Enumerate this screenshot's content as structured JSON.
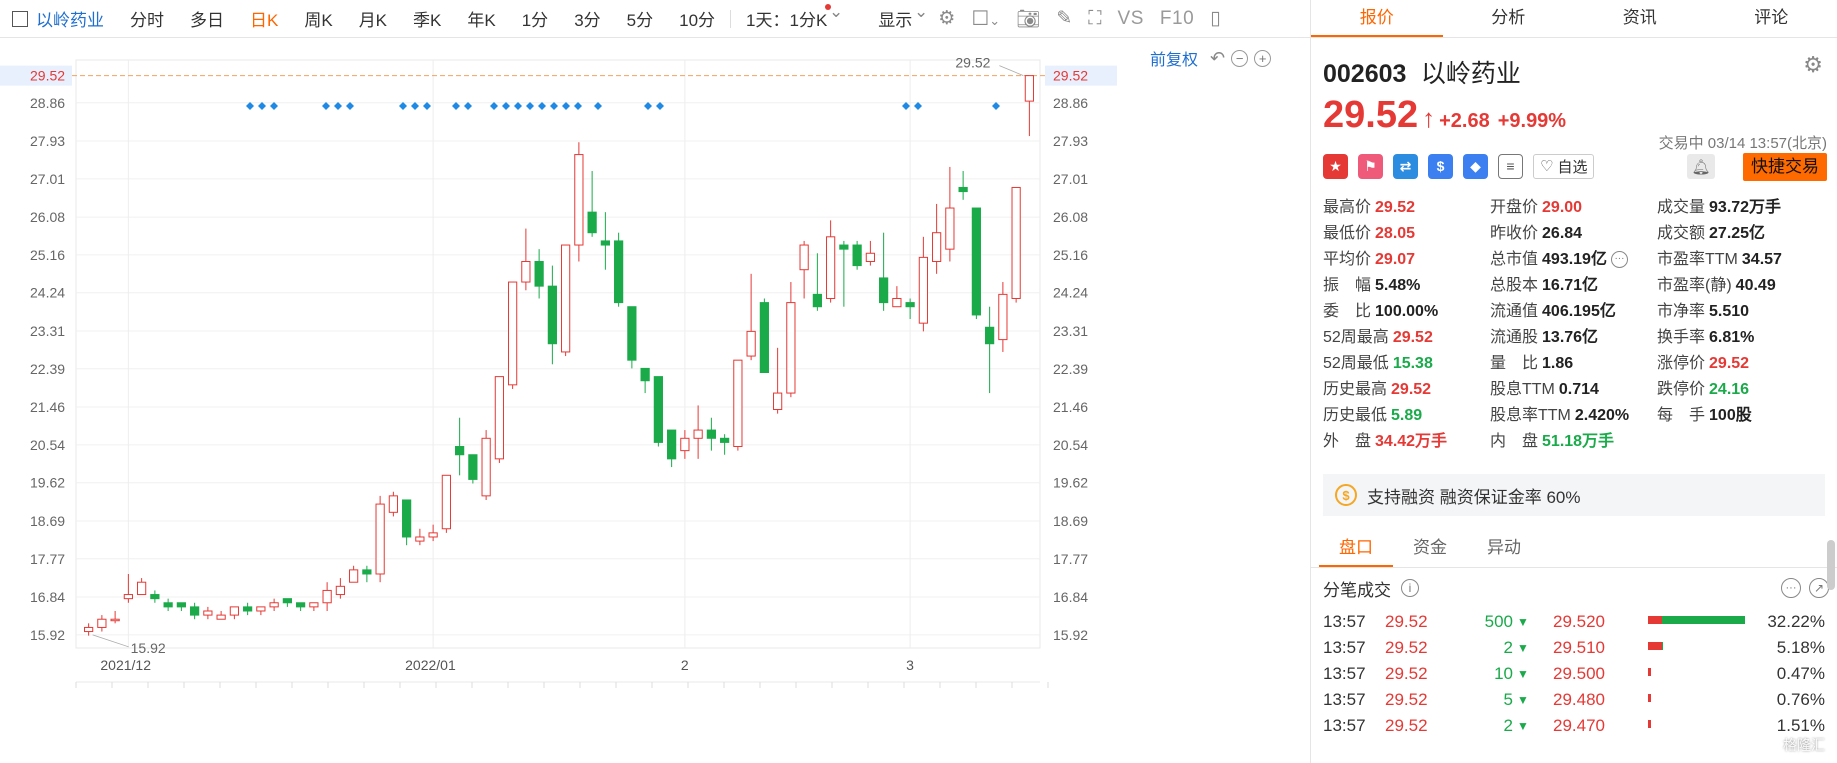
{
  "toolbar": {
    "stock_name": "以岭药业",
    "periods": [
      "分时",
      "多日",
      "日K",
      "周K",
      "月K",
      "季K",
      "年K",
      "1分",
      "3分",
      "5分",
      "10分"
    ],
    "active_period": "日K",
    "multi_range": "1天：1分K",
    "display": "显示",
    "vs": "VS",
    "f10": "F10"
  },
  "chart_tools": {
    "adjust": "前复权"
  },
  "kline": {
    "price_levels": [
      "15.92",
      "16.84",
      "17.77",
      "18.69",
      "19.62",
      "20.54",
      "21.46",
      "22.39",
      "23.31",
      "24.24",
      "25.16",
      "26.08",
      "27.01",
      "27.93",
      "28.86"
    ],
    "current_price_label": "29.52",
    "high_label": "29.52",
    "low_label": "15.92",
    "date_labels": [
      {
        "text": "2021/12",
        "index": 3
      },
      {
        "text": "2022/01",
        "index": 26
      },
      {
        "text": "2",
        "index": 45
      },
      {
        "text": "3",
        "index": 62
      }
    ],
    "ymin": 15.6,
    "ymax": 29.9,
    "candles": [
      [
        16.0,
        16.1,
        15.9,
        16.2
      ],
      [
        16.1,
        16.3,
        16.0,
        16.4
      ],
      [
        16.3,
        16.3,
        16.2,
        16.5
      ],
      [
        16.8,
        16.9,
        16.7,
        17.4
      ],
      [
        16.9,
        17.2,
        16.9,
        17.3
      ],
      [
        16.9,
        16.8,
        16.7,
        17.0
      ],
      [
        16.7,
        16.6,
        16.5,
        16.8
      ],
      [
        16.7,
        16.6,
        16.5,
        16.7
      ],
      [
        16.6,
        16.4,
        16.3,
        16.7
      ],
      [
        16.4,
        16.5,
        16.3,
        16.6
      ],
      [
        16.3,
        16.4,
        16.3,
        16.5
      ],
      [
        16.4,
        16.6,
        16.3,
        16.6
      ],
      [
        16.6,
        16.5,
        16.4,
        16.7
      ],
      [
        16.5,
        16.6,
        16.4,
        16.6
      ],
      [
        16.6,
        16.7,
        16.5,
        16.8
      ],
      [
        16.8,
        16.7,
        16.6,
        16.8
      ],
      [
        16.7,
        16.6,
        16.5,
        16.7
      ],
      [
        16.6,
        16.7,
        16.5,
        16.7
      ],
      [
        16.7,
        17.0,
        16.5,
        17.2
      ],
      [
        16.9,
        17.1,
        16.8,
        17.3
      ],
      [
        17.2,
        17.5,
        17.2,
        17.6
      ],
      [
        17.5,
        17.4,
        17.2,
        17.6
      ],
      [
        17.4,
        19.1,
        17.2,
        19.3
      ],
      [
        18.9,
        19.3,
        18.8,
        19.4
      ],
      [
        19.2,
        18.3,
        18.1,
        19.2
      ],
      [
        18.2,
        18.3,
        18.1,
        18.5
      ],
      [
        18.3,
        18.4,
        18.2,
        18.6
      ],
      [
        18.5,
        19.8,
        18.4,
        19.8
      ],
      [
        20.5,
        20.3,
        19.8,
        21.2
      ],
      [
        20.3,
        19.7,
        19.6,
        20.3
      ],
      [
        19.3,
        20.7,
        19.2,
        20.9
      ],
      [
        20.2,
        22.2,
        20.1,
        22.2
      ],
      [
        22.0,
        24.5,
        21.9,
        24.5
      ],
      [
        24.5,
        25.0,
        24.3,
        25.8
      ],
      [
        25.0,
        24.4,
        24.1,
        25.3
      ],
      [
        24.4,
        23.0,
        22.5,
        24.9
      ],
      [
        22.8,
        25.4,
        22.7,
        25.4
      ],
      [
        25.4,
        27.6,
        25.0,
        27.9
      ],
      [
        26.2,
        25.7,
        25.6,
        27.2
      ],
      [
        25.5,
        25.4,
        24.8,
        26.2
      ],
      [
        25.5,
        24.0,
        23.9,
        25.7
      ],
      [
        23.9,
        22.6,
        22.4,
        23.9
      ],
      [
        22.4,
        22.1,
        21.8,
        22.4
      ],
      [
        22.2,
        20.6,
        20.5,
        22.2
      ],
      [
        20.9,
        20.2,
        20.0,
        20.9
      ],
      [
        20.4,
        20.7,
        20.2,
        20.9
      ],
      [
        20.7,
        20.9,
        20.2,
        21.5
      ],
      [
        20.9,
        20.7,
        20.4,
        21.2
      ],
      [
        20.7,
        20.6,
        20.3,
        20.8
      ],
      [
        20.5,
        22.6,
        20.4,
        22.6
      ],
      [
        22.7,
        23.3,
        22.6,
        24.7
      ],
      [
        24.0,
        22.3,
        22.3,
        24.1
      ],
      [
        21.4,
        21.8,
        21.3,
        22.9
      ],
      [
        21.8,
        24.0,
        21.7,
        24.5
      ],
      [
        24.8,
        25.4,
        24.1,
        25.5
      ],
      [
        24.2,
        23.9,
        23.8,
        25.2
      ],
      [
        24.1,
        25.6,
        24.0,
        26.0
      ],
      [
        25.4,
        25.3,
        23.9,
        25.5
      ],
      [
        25.4,
        24.9,
        24.8,
        25.5
      ],
      [
        25.0,
        25.2,
        24.9,
        25.5
      ],
      [
        24.6,
        24.0,
        23.8,
        25.7
      ],
      [
        23.9,
        24.1,
        23.9,
        24.4
      ],
      [
        24.0,
        23.9,
        23.6,
        24.1
      ],
      [
        23.5,
        25.1,
        23.3,
        25.6
      ],
      [
        25.0,
        25.7,
        24.7,
        26.4
      ],
      [
        25.3,
        26.3,
        25.0,
        27.3
      ],
      [
        26.8,
        26.7,
        26.5,
        27.2
      ],
      [
        26.3,
        23.7,
        23.6,
        26.3
      ],
      [
        23.4,
        23.0,
        21.8,
        23.9
      ],
      [
        23.1,
        24.2,
        22.8,
        24.5
      ],
      [
        24.1,
        26.8,
        24.0,
        26.8
      ],
      [
        28.9,
        29.52,
        28.05,
        29.52
      ]
    ]
  },
  "panel": {
    "tabs": [
      "报价",
      "分析",
      "资讯",
      "评论"
    ],
    "active_tab": "报价",
    "code": "002603",
    "name": "以岭药业",
    "price": "29.52",
    "change": "+2.68",
    "change_pct": "+9.99%",
    "status": "交易中 03/14 13:57(北京)",
    "self_pick": "自选",
    "quick_trade": "快捷交易",
    "stats": [
      [
        {
          "l": "最高价",
          "v": "29.52",
          "c": "red"
        },
        {
          "l": "开盘价",
          "v": "29.00",
          "c": "red"
        },
        {
          "l": "成交量",
          "v": "93.72万手",
          "c": ""
        }
      ],
      [
        {
          "l": "最低价",
          "v": "28.05",
          "c": "red"
        },
        {
          "l": "昨收价",
          "v": "26.84",
          "c": ""
        },
        {
          "l": "成交额",
          "v": "27.25亿",
          "c": ""
        }
      ],
      [
        {
          "l": "平均价",
          "v": "29.07",
          "c": "red"
        },
        {
          "l": "总市值",
          "v": "493.19亿",
          "c": ""
        },
        {
          "l": "市盈率TTM",
          "v": "34.57",
          "c": ""
        }
      ],
      [
        {
          "l": "振　幅",
          "v": "5.48%",
          "c": ""
        },
        {
          "l": "总股本",
          "v": "16.71亿",
          "c": ""
        },
        {
          "l": "市盈率(静)",
          "v": "40.49",
          "c": ""
        }
      ],
      [
        {
          "l": "委　比",
          "v": "100.00%",
          "c": ""
        },
        {
          "l": "流通值",
          "v": "406.195亿",
          "c": ""
        },
        {
          "l": "市净率",
          "v": "5.510",
          "c": ""
        }
      ],
      [
        {
          "l": "52周最高",
          "v": "29.52",
          "c": "red"
        },
        {
          "l": "流通股",
          "v": "13.76亿",
          "c": ""
        },
        {
          "l": "换手率",
          "v": "6.81%",
          "c": ""
        }
      ],
      [
        {
          "l": "52周最低",
          "v": "15.38",
          "c": "green"
        },
        {
          "l": "量　比",
          "v": "1.86",
          "c": ""
        },
        {
          "l": "涨停价",
          "v": "29.52",
          "c": "red"
        }
      ],
      [
        {
          "l": "历史最高",
          "v": "29.52",
          "c": "red"
        },
        {
          "l": "股息TTM",
          "v": "0.714",
          "c": ""
        },
        {
          "l": "跌停价",
          "v": "24.16",
          "c": "green"
        }
      ],
      [
        {
          "l": "历史最低",
          "v": "5.89",
          "c": "green"
        },
        {
          "l": "股息率TTM",
          "v": "2.420%",
          "c": ""
        },
        {
          "l": "每　手",
          "v": "100股",
          "c": ""
        }
      ],
      [
        {
          "l": "外　盘",
          "v": "34.42万手",
          "c": "red"
        },
        {
          "l": "内　盘",
          "v": "51.18万手",
          "c": "green"
        },
        null
      ]
    ],
    "margin_text": "支持融资 融资保证金率 60%",
    "subtabs": [
      "盘口",
      "资金",
      "异动"
    ],
    "ticks_title": "分笔成交",
    "ticks": [
      {
        "t": "13:57",
        "p": "29.52",
        "v": "500",
        "lv": "29.520",
        "pct": "32.22%",
        "bar": 0.97
      },
      {
        "t": "13:57",
        "p": "29.52",
        "v": "2",
        "lv": "29.510",
        "pct": "5.18%",
        "bar": 0.15
      },
      {
        "t": "13:57",
        "p": "29.52",
        "v": "10",
        "lv": "29.500",
        "pct": "0.47%",
        "bar": 0.02
      },
      {
        "t": "13:57",
        "p": "29.52",
        "v": "5",
        "lv": "29.480",
        "pct": "0.76%",
        "bar": 0.02
      },
      {
        "t": "13:57",
        "p": "29.52",
        "v": "2",
        "lv": "29.470",
        "pct": "1.51%",
        "bar": 0.03
      }
    ],
    "watermark": "格隆汇"
  }
}
